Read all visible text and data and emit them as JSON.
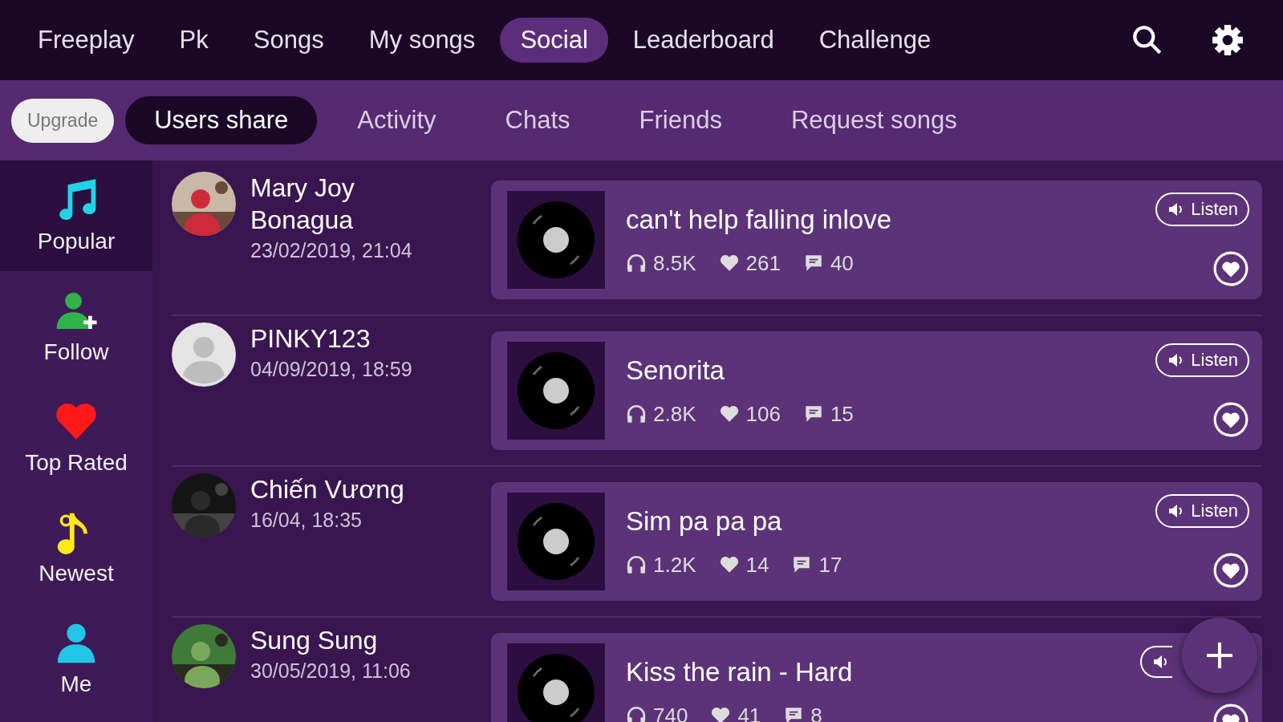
{
  "top_tabs": [
    {
      "label": "Freeplay",
      "selected": false
    },
    {
      "label": "Pk",
      "selected": false
    },
    {
      "label": "Songs",
      "selected": false
    },
    {
      "label": "My songs",
      "selected": false
    },
    {
      "label": "Social",
      "selected": true
    },
    {
      "label": "Leaderboard",
      "selected": false
    },
    {
      "label": "Challenge",
      "selected": false
    }
  ],
  "upgrade": "Upgrade",
  "sub_tabs": [
    {
      "label": "Users share",
      "selected": true
    },
    {
      "label": "Activity",
      "selected": false
    },
    {
      "label": "Chats",
      "selected": false
    },
    {
      "label": "Friends",
      "selected": false
    },
    {
      "label": "Request songs",
      "selected": false
    }
  ],
  "sidebar": [
    {
      "label": "Popular",
      "kind": "note",
      "color": "#22d3e6",
      "selected": true
    },
    {
      "label": "Follow",
      "kind": "add-user",
      "color": "#2fb34a",
      "selected": false
    },
    {
      "label": "Top Rated",
      "kind": "heart",
      "color": "#ff1a1a",
      "selected": false
    },
    {
      "label": "Newest",
      "kind": "note2",
      "color": "#ffe81a",
      "selected": false
    },
    {
      "label": "Me",
      "kind": "user",
      "color": "#22c6e6",
      "selected": false
    }
  ],
  "posts": [
    {
      "user": "Mary Joy Bonagua",
      "date": "23/02/2019, 21:04",
      "song": "can't help falling inlove",
      "listens": "8.5K",
      "likes": "261",
      "comments": "40",
      "listen": "Listen"
    },
    {
      "user": "PINKY123",
      "date": "04/09/2019, 18:59",
      "avatar": {
        "kind": "default"
      },
      "song": "Senorita",
      "listens": "2.8K",
      "likes": "106",
      "comments": "15",
      "listen": "Listen"
    },
    {
      "user": "Chiến Vương",
      "date": "16/04, 18:35",
      "avatar": {
        "kind": "dark"
      },
      "song": "Sim pa pa pa",
      "listens": "1.2K",
      "likes": "14",
      "comments": "17",
      "listen": "Listen"
    },
    {
      "user": "Sung Sung",
      "date": "30/05/2019, 11:06",
      "avatar": {
        "kind": "green"
      },
      "song": "Kiss the rain - Hard",
      "listens": "740",
      "likes": "41",
      "comments": "8"
    }
  ]
}
